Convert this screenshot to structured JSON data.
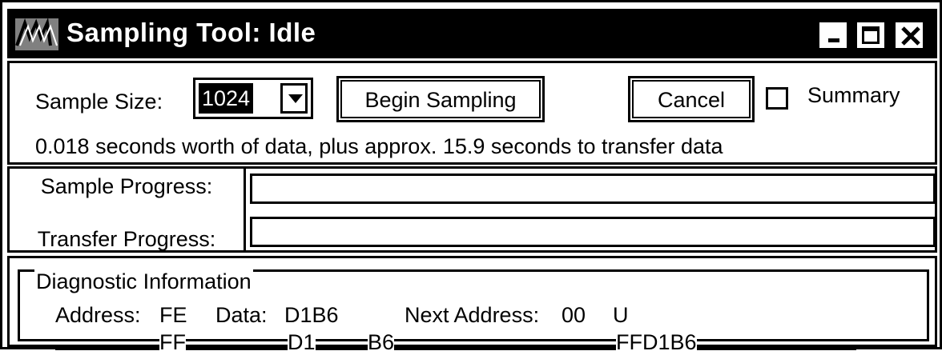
{
  "window": {
    "title": "Sampling Tool: Idle"
  },
  "controls": {
    "sample_size_label": "Sample Size:",
    "sample_size_value": "1024",
    "begin_label": "Begin Sampling",
    "cancel_label": "Cancel",
    "summary_label": "Summary",
    "summary_checked": false,
    "info_text": "0.018 seconds worth of data, plus approx. 15.9 seconds to transfer data"
  },
  "progress": {
    "sample_label": "Sample Progress:",
    "sample_value": 0,
    "transfer_label": "Transfer Progress:",
    "transfer_value": 0
  },
  "diagnostics": {
    "title": "Diagnostic Information",
    "address_label": "Address:",
    "address_value": "FE",
    "data_label": "Data:",
    "data_value": "D1B6",
    "next_address_label": "Next Address:",
    "next_address_value": "00",
    "u_value": "U",
    "row2": [
      "FF",
      "D1",
      "B6",
      "FFD1B6"
    ]
  }
}
